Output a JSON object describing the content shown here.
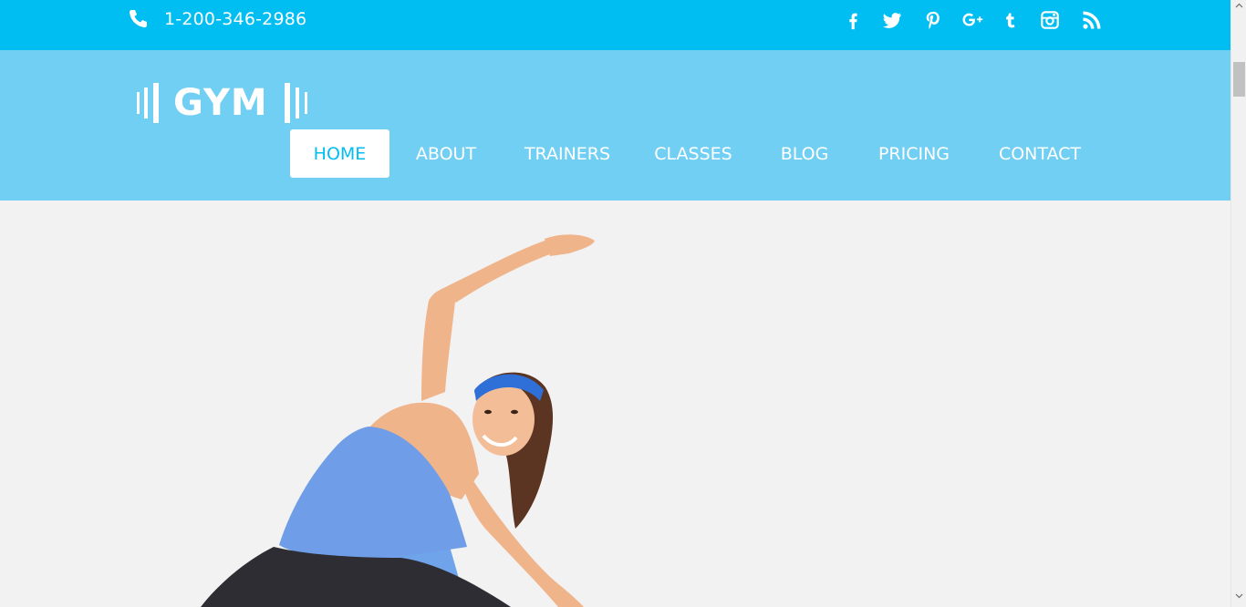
{
  "topbar": {
    "phone": "1-200-346-2986",
    "phone_icon": "phone-icon",
    "social": [
      {
        "name": "facebook-icon",
        "glyph": "f"
      },
      {
        "name": "twitter-icon",
        "glyph": "twitter"
      },
      {
        "name": "pinterest-icon",
        "glyph": "p"
      },
      {
        "name": "google-plus-icon",
        "glyph": "g+"
      },
      {
        "name": "tumblr-icon",
        "glyph": "t"
      },
      {
        "name": "instagram-icon",
        "glyph": "instagram"
      },
      {
        "name": "rss-icon",
        "glyph": "rss"
      }
    ]
  },
  "header": {
    "logo": "GYM",
    "nav": [
      "HOME",
      "ABOUT",
      "TRAINERS",
      "CLASSES",
      "BLOG",
      "PRICING",
      "CONTACT"
    ],
    "active_nav": "HOME"
  },
  "colors": {
    "topbar": "#00bdf2",
    "header": "#72cff4",
    "hero_bg": "#f2f2f2",
    "accent": "#00bdf2",
    "headband": "#2f6fd8",
    "tank_top": "#6f9de8",
    "mat": "#6fa4ea",
    "skin": "#f0b48b",
    "hair": "#5b3522",
    "leggings": "#2d2d33"
  }
}
